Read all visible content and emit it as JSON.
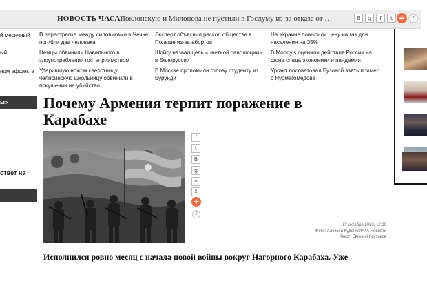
{
  "topbar": {
    "label": "НОВОСТЬ ЧАСА:",
    "headline": "Поклонскую и Милонова не пустили в Госдуму из-за отказа от …",
    "share_icons": [
      "В",
      "g",
      "f",
      "t"
    ],
    "share_count": "2"
  },
  "news_left_cut": [
    "й месячный",
    "ый",
    "ном эффекте"
  ],
  "news": [
    "В перестрелке между силовиками в Чечне погибли два человека",
    "Эксперт объяснил раскол общества в Польше из-за абортов",
    "На Украине повысили цену на газ для населения на 35%",
    "Немцы обвинили Навального в злоупотреблении гостеприимством",
    "Шойгу назвал цель «цветной революции» в Белоруссии",
    "В Moody's оценили действия России на фоне спада экономики и пандемии",
    "Ударившую ножом сверстницу челябинскую школьницу обвинили в покушении на убийство",
    "В Москве проломили голову студенту из Бурунди",
    "Ургант посоветовал Бузовой взять пример с Нурмагомедова"
  ],
  "left_sidebar": {
    "bar_top": "ы»",
    "cut_text": "ответ на",
    "bar_bottom": ""
  },
  "article": {
    "title": "Почему Армения терпит поражение в Карабахе",
    "date": "27 октября 2020, 12:30",
    "photo_credit": "Фото: Алексей Куденко/РИА Новости",
    "text_credit": "Текст: Евгений Крутиков",
    "lead": "Исполнился ровно месяц с начала новой войны вокруг Нагорного Карабаха. Уже",
    "share_icons": [
      "f",
      "t",
      "В",
      "g",
      "✉",
      "⎙"
    ],
    "share_count": "2"
  },
  "colors": {
    "accent": "#f0693c",
    "topbar_bg": "#ededed",
    "dark_bar": "#3a3a3a"
  }
}
